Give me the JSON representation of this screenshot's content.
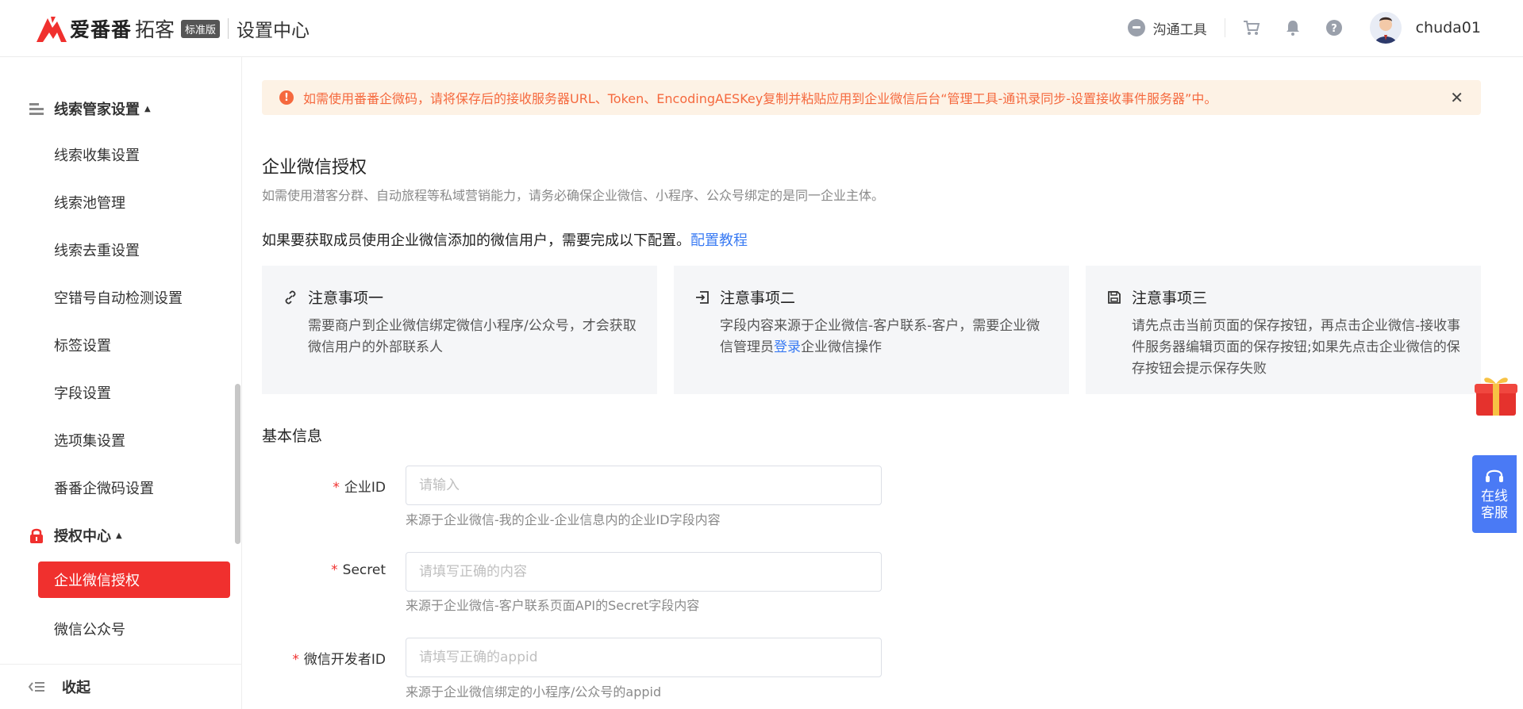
{
  "header": {
    "logo_brand": "爱番番",
    "logo_sub": "拓客",
    "badge": "标准版",
    "title": "设置中心",
    "comm_tool": "沟通工具",
    "username": "chuda01"
  },
  "sidebar": {
    "group_leads": "线索管家设置",
    "items_leads": [
      "线索收集设置",
      "线索池管理",
      "线索去重设置",
      "空错号自动检测设置",
      "标签设置",
      "字段设置",
      "选项集设置",
      "番番企微码设置"
    ],
    "group_auth": "授权中心",
    "items_auth": [
      "企业微信授权",
      "微信公众号"
    ],
    "collapse": "收起"
  },
  "alert": {
    "text": "如需使用番番企微码，请将保存后的接收服务器URL、Token、EncodingAESKey复制并粘贴应用到企业微信后台“管理工具-通讯录同步-设置接收事件服务器”中。"
  },
  "main": {
    "title": "企业微信授权",
    "desc": "如需使用潜客分群、自动旅程等私域营销能力，请务必确保企业微信、小程序、公众号绑定的是同一企业主体。",
    "note": "如果要获取成员使用企业微信添加的微信用户，需要完成以下配置。",
    "note_link": "配置教程",
    "notices": [
      {
        "title": "注意事项一",
        "body": "需要商户到企业微信绑定微信小程序/公众号，才会获取微信用户的外部联系人"
      },
      {
        "title": "注意事项二",
        "body_pre": "字段内容来源于企业微信-客户联系-客户，需要企业微信管理员",
        "body_link": "登录",
        "body_post": "企业微信操作"
      },
      {
        "title": "注意事项三",
        "body": "请先点击当前页面的保存按钮，再点击企业微信-接收事件服务器编辑页面的保存按钮;如果先点击企业微信的保存按钮会提示保存失败"
      }
    ],
    "basic_title": "基本信息",
    "fields": [
      {
        "required": "*",
        "label": "企业ID",
        "placeholder": "请输入",
        "help": "来源于企业微信-我的企业-企业信息内的企业ID字段内容"
      },
      {
        "required": "*",
        "label": "Secret",
        "placeholder": "请填写正确的内容",
        "help": "来源于企业微信-客户联系页面API的Secret字段内容"
      },
      {
        "required": "*",
        "label": "微信开发者ID",
        "placeholder": "请填写正确的appid",
        "help": "来源于企业微信绑定的小程序/公众号的appid"
      }
    ]
  },
  "float": {
    "service": "在线客服"
  },
  "colors": {
    "brand_red": "#f0302e",
    "link_blue": "#3a7bf3",
    "alert_orange": "#f5693e",
    "service_blue": "#4a7af5"
  }
}
